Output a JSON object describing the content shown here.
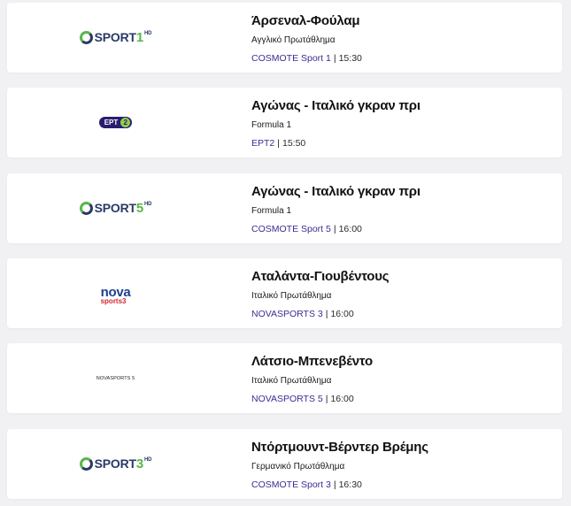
{
  "events": [
    {
      "title": "Άρσεναλ-Φούλαμ",
      "competition": "Αγγλικό Πρωτάθλημα",
      "channel": "COSMOTE Sport 1",
      "separator": "|",
      "time": "15:30",
      "logo": {
        "brand": "SPORT",
        "number": "1",
        "hd": "HD"
      }
    },
    {
      "title": "Αγώνας - Ιταλικό γκραν πρι",
      "competition": "Formula 1",
      "channel": "ΕΡΤ2",
      "separator": "|",
      "time": "15:50",
      "logo": {
        "brand": "ΕΡΤ",
        "number": "2"
      }
    },
    {
      "title": "Αγώνας - Ιταλικό γκραν πρι",
      "competition": "Formula 1",
      "channel": "COSMOTE Sport 5",
      "separator": "|",
      "time": "16:00",
      "logo": {
        "brand": "SPORT",
        "number": "5",
        "hd": "HD"
      }
    },
    {
      "title": "Αταλάντα-Γιουβέντους",
      "competition": "Ιταλικό Πρωτάθλημα",
      "channel": "NOVASPORTS 3",
      "separator": "|",
      "time": "16:00",
      "logo": {
        "brand": "nova",
        "sub": "sports3"
      }
    },
    {
      "title": "Λάτσιο-Μπενεβέντο",
      "competition": "Ιταλικό Πρωτάθλημα",
      "channel": "NOVASPORTS 5",
      "separator": "|",
      "time": "16:00",
      "logo": {
        "text": "NOVASPORTS 5"
      }
    },
    {
      "title": "Ντόρτμουντ-Βέρντερ Βρέμης",
      "competition": "Γερμανικό Πρωτάθλημα",
      "channel": "COSMOTE Sport 3",
      "separator": "|",
      "time": "16:30",
      "logo": {
        "brand": "SPORT",
        "number": "3",
        "hd": "HD"
      }
    }
  ],
  "colors": {
    "channel_link": "#3d2b93",
    "cosmote_green": "#5bb54a",
    "cosmote_navy": "#2a3a66",
    "ert_purple": "#2a1d6e",
    "ert_green": "#8fd04a",
    "nova_blue": "#1e3f8e",
    "nova_red": "#d7262f",
    "page_bg": "#f1f1f3",
    "card_bg": "#ffffff"
  }
}
